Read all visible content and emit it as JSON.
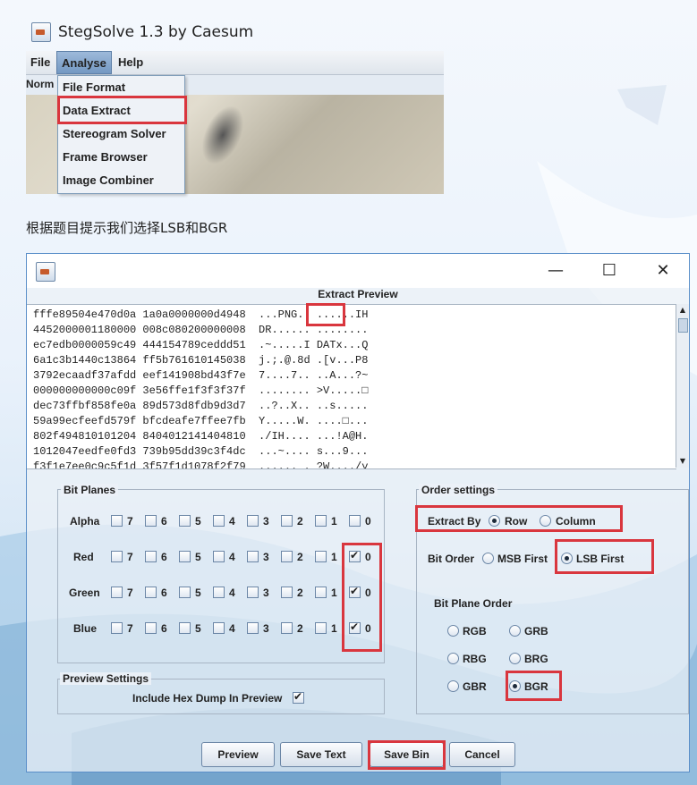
{
  "app": {
    "title": "StegSolve 1.3 by Caesum"
  },
  "menu": {
    "file": "File",
    "analyse": "Analyse",
    "help": "Help",
    "subbar_text": "Norm"
  },
  "analyse_menu": [
    "File Format",
    "Data Extract",
    "Stereogram Solver",
    "Frame Browser",
    "Image Combiner"
  ],
  "caption": "根据题目提示我们选择LSB和BGR",
  "dialog": {
    "controls": {
      "minimize": "—",
      "maximize": "☐",
      "close": "✕"
    },
    "preview_title": "Extract Preview",
    "hex_lines": [
      "fffe89504e470d0a 1a0a0000000d4948  ...PNG.  ......IH",
      "4452000001180000 008c080200000008  DR...... ........",
      "ec7edb0000059c49 444154789ceddd51  .~.....I DATx...Q",
      "6a1c3b1440c13864 ff5b761610145038  j.;.@.8d .[v...P8",
      "3792ecaadf37afdd eef141908bd43f7e  7....7.. ..A...?~",
      "000000000000c09f 3e56ffe1f3f3f37f  ........ >V.....□",
      "dec73ffbf858fe0a 89d573d8fdb9d3d7  ..?..X.. ..s.....",
      "59a99ecfeefd579f bfcdeafe7ffee7fb  Y.....W. ....□...",
      "802f494810101204 8404012141404810  ./IH.... ...!A@H.",
      "1012047eedfe0fd3 739b95dd39c3f4dc  ...~.... s...9...",
      "f3f1e7ee0c9c5f1d 3f57f1d1078f2f79  ......_. ?W..../y"
    ],
    "bit_planes": {
      "title": "Bit Planes",
      "rows": [
        {
          "label": "Alpha",
          "checked": []
        },
        {
          "label": "Red",
          "checked": [
            "0"
          ]
        },
        {
          "label": "Green",
          "checked": [
            "0"
          ]
        },
        {
          "label": "Blue",
          "checked": [
            "0"
          ]
        }
      ],
      "bits": [
        "7",
        "6",
        "5",
        "4",
        "3",
        "2",
        "1",
        "0"
      ]
    },
    "preview_settings": {
      "title": "Preview Settings",
      "include_hex_label": "Include Hex Dump In Preview",
      "include_hex_checked": true
    },
    "order_settings": {
      "title": "Order settings",
      "extract_by_label": "Extract By",
      "extract_by_options": [
        "Row",
        "Column"
      ],
      "extract_by_selected": "Row",
      "bit_order_label": "Bit Order",
      "bit_order_options": [
        "MSB First",
        "LSB First"
      ],
      "bit_order_selected": "LSB First",
      "bit_plane_order_label": "Bit Plane Order",
      "bit_plane_order_options": [
        "RGB",
        "GRB",
        "RBG",
        "BRG",
        "GBR",
        "BGR"
      ],
      "bit_plane_order_selected": "BGR"
    },
    "buttons": {
      "preview": "Preview",
      "save_text": "Save Text",
      "save_bin": "Save Bin",
      "cancel": "Cancel"
    }
  },
  "colors": {
    "highlight_box": "#d9363e",
    "menu_active": "#7398c2",
    "dialog_border": "#5b8fc9"
  }
}
